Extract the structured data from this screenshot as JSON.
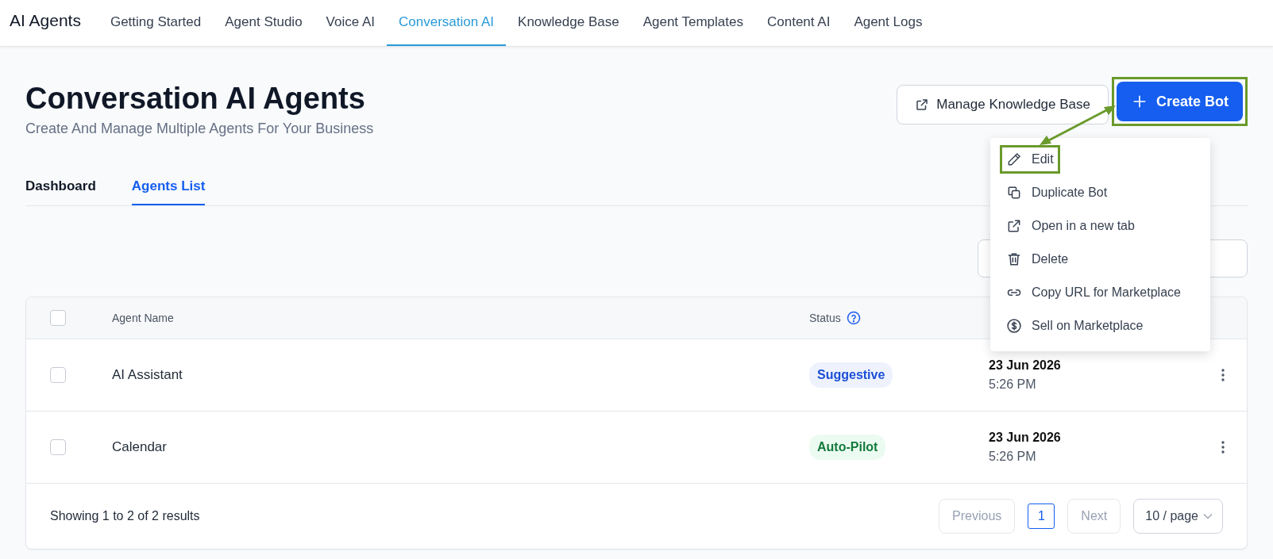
{
  "nav": {
    "brand": "AI Agents",
    "tabs": [
      {
        "label": "Getting Started",
        "selected": false
      },
      {
        "label": "Agent Studio",
        "selected": false
      },
      {
        "label": "Voice AI",
        "selected": false
      },
      {
        "label": "Conversation AI",
        "selected": true
      },
      {
        "label": "Knowledge Base",
        "selected": false
      },
      {
        "label": "Agent Templates",
        "selected": false
      },
      {
        "label": "Content AI",
        "selected": false
      },
      {
        "label": "Agent Logs",
        "selected": false
      }
    ]
  },
  "header": {
    "title": "Conversation AI Agents",
    "subtitle": "Create And Manage Multiple Agents For Your Business",
    "manage_button": "Manage Knowledge Base",
    "create_button": {
      "label": "Create Bot",
      "annotated": true
    }
  },
  "view_tabs": [
    {
      "label": "Dashboard",
      "selected": false
    },
    {
      "label": "Agents List",
      "selected": true
    }
  ],
  "table": {
    "select_all": false,
    "columns": [
      "Agent Name",
      "Status"
    ],
    "rows": [
      {
        "checked": false,
        "name": "AI Assistant",
        "status": {
          "label": "Suggestive",
          "kind": "suggestive"
        },
        "date": "23 Jun 2026",
        "time": "5:26 PM"
      },
      {
        "checked": false,
        "name": "Calendar",
        "status": {
          "label": "Auto-Pilot",
          "kind": "autopilot"
        },
        "date": "23 Jun 2026",
        "time": "5:26 PM"
      }
    ]
  },
  "pagination": {
    "summary": "Showing 1 to 2 of 2 results",
    "previous": "Previous",
    "pages": [
      {
        "label": "1",
        "selected": true
      }
    ],
    "next": "Next",
    "page_size": "10 / page"
  },
  "context_menu": {
    "items": [
      {
        "kind": "edit",
        "label": "Edit",
        "annotated": true
      },
      {
        "kind": "duplicate",
        "label": "Duplicate Bot",
        "annotated": false
      },
      {
        "kind": "open",
        "label": "Open in a new tab",
        "annotated": false
      },
      {
        "kind": "delete",
        "label": "Delete",
        "annotated": false
      },
      {
        "kind": "link",
        "label": "Copy URL for Marketplace",
        "annotated": false
      },
      {
        "kind": "sell",
        "label": "Sell on Marketplace",
        "annotated": false
      }
    ]
  }
}
